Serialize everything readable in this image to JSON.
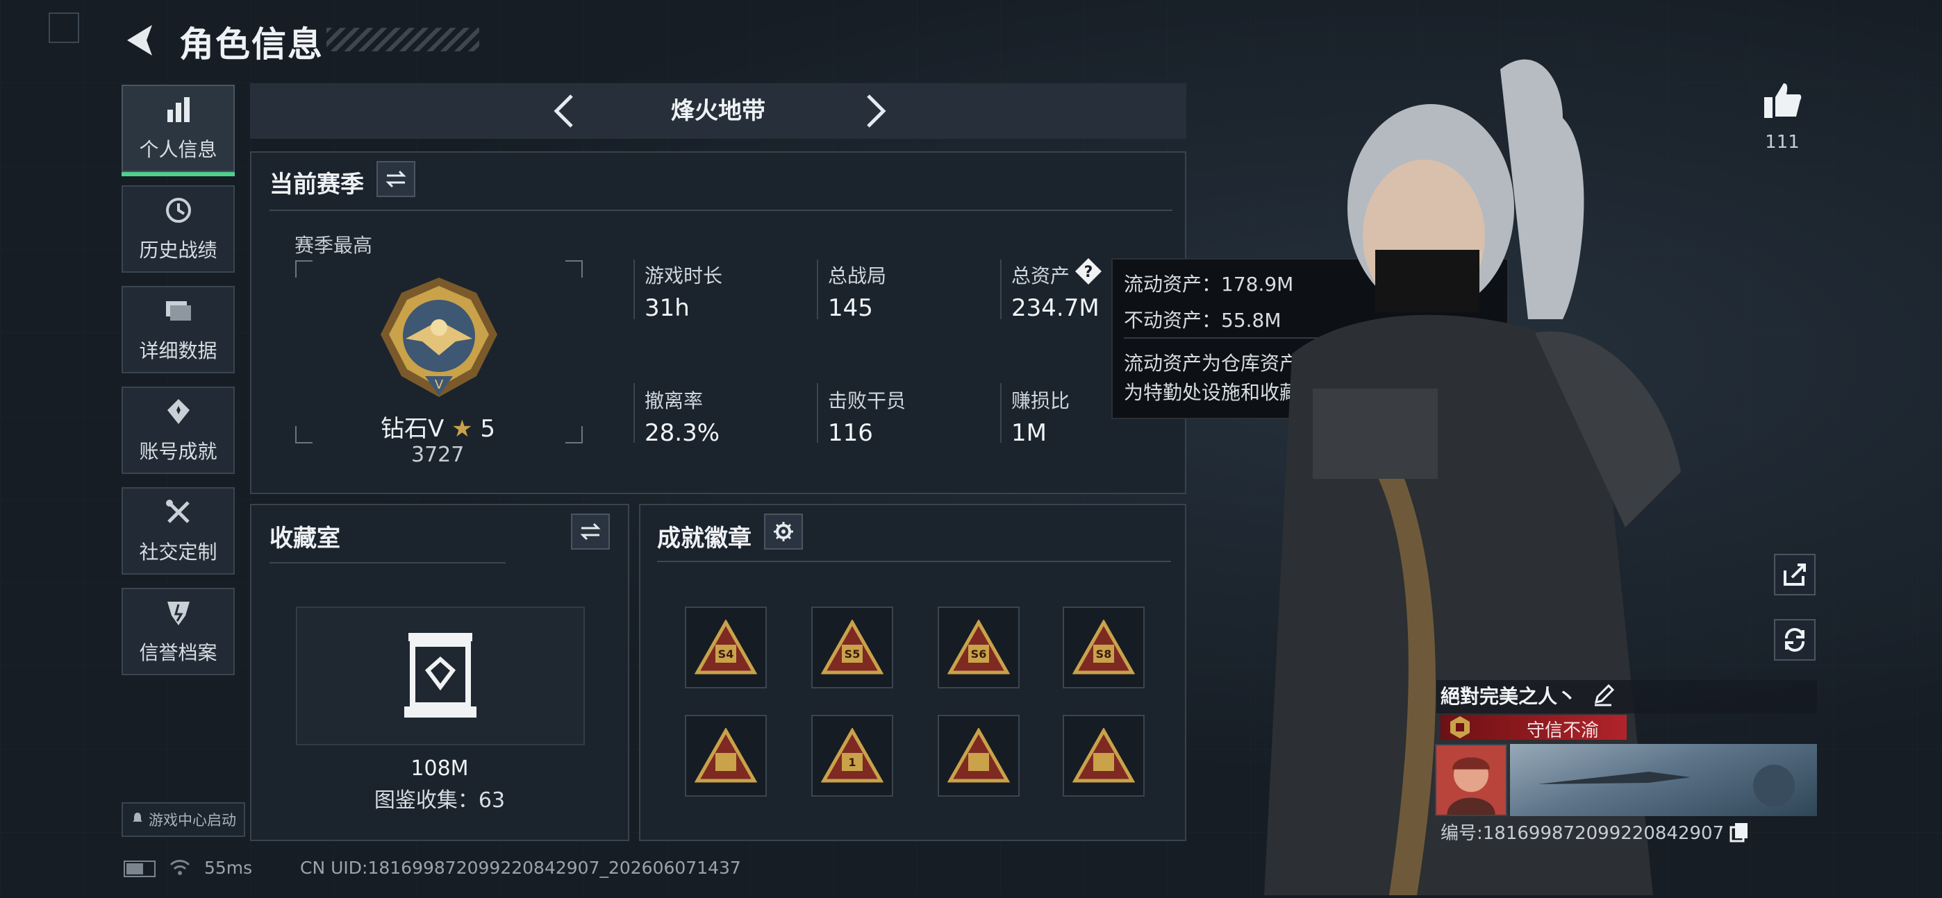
{
  "header": {
    "title": "角色信息"
  },
  "sidebar": {
    "items": [
      {
        "label": "个人信息",
        "icon": "bar-chart-icon",
        "active": true
      },
      {
        "label": "历史战绩",
        "icon": "history-icon"
      },
      {
        "label": "详细数据",
        "icon": "folder-icon"
      },
      {
        "label": "账号成就",
        "icon": "achievement-icon"
      },
      {
        "label": "社交定制",
        "icon": "tools-icon"
      },
      {
        "label": "信誉档案",
        "icon": "shield-icon"
      }
    ],
    "launch_label": "游戏中心启动"
  },
  "mode": {
    "title": "烽火地带"
  },
  "season": {
    "title": "当前赛季",
    "best_label": "赛季最高",
    "rank_name": "钻石V",
    "rank_stars": "5",
    "rank_score": "3727",
    "stats": [
      {
        "label": "游戏时长",
        "value": "31h"
      },
      {
        "label": "总战局",
        "value": "145"
      },
      {
        "label": "总资产",
        "value": "234.7M"
      },
      {
        "label": "撤离率",
        "value": "28.3%"
      },
      {
        "label": "击败干员",
        "value": "116"
      },
      {
        "label": "赚损比",
        "value": "1M"
      }
    ]
  },
  "tooltip": {
    "liquid": "流动资产：178.9M",
    "fixed": "不动资产：55.8M",
    "desc1": "流动资产为仓库资产和哈夫币，不动资产",
    "desc2": "为特勤处设施和收藏室设施"
  },
  "collection": {
    "title": "收藏室",
    "value": "108M",
    "count_text": "图鉴收集：63"
  },
  "achievements": {
    "title": "成就徽章",
    "badges": [
      "S4",
      "S5",
      "S6",
      "S8",
      "",
      "1",
      "",
      ""
    ]
  },
  "profile": {
    "likes": "111",
    "name": "絕對完美之人丶",
    "title_badge": "守信不渝",
    "id_text": "编号:1816998720992208​42907"
  },
  "status_bar": {
    "ping": "55ms",
    "uid": "CN UID:1816998720992208​42907_202606071437"
  },
  "colors": {
    "accent": "#4fd18b",
    "gold": "#c9a24a",
    "danger": "#b0242a"
  }
}
